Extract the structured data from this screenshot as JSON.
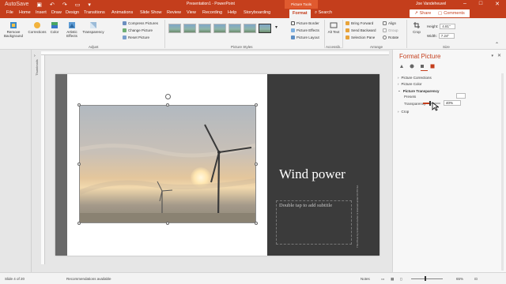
{
  "titlebar": {
    "autosave": "AutoSave",
    "document_title": "Presentation1 - PowerPoint",
    "context_tab": "Picture Tools",
    "user": "Joe Vandeheuvel"
  },
  "tabs": [
    "File",
    "Home",
    "Insert",
    "Draw",
    "Design",
    "Transitions",
    "Animations",
    "Slide Show",
    "Review",
    "View",
    "Recording",
    "Help",
    "Storyboarding",
    "Format"
  ],
  "active_tab": "Format",
  "search_label": "Search",
  "share_label": "Share",
  "comments_label": "Comments",
  "ribbon": {
    "remove_background": "Remove Background",
    "corrections": "Corrections",
    "color": "Color",
    "artistic_effects": "Artistic Effects",
    "transparency": "Transparency",
    "compress_pictures": "Compress Pictures",
    "change_picture": "Change Picture",
    "reset_picture": "Reset Picture",
    "group_adjust": "Adjust",
    "group_picture_styles": "Picture Styles",
    "picture_border": "Picture Border",
    "picture_effects": "Picture Effects",
    "picture_layout": "Picture Layout",
    "group_accessibility": "Accessib...",
    "alt_text": "Alt Text",
    "bring_forward": "Bring Forward",
    "send_backward": "Send Backward",
    "selection_pane": "Selection Pane",
    "align": "Align",
    "group": "Group",
    "rotate": "Rotate",
    "group_arrange": "Arrange",
    "crop": "Crop",
    "height_label": "Height:",
    "height_value": "4.81\"",
    "width_label": "Width:",
    "width_value": "7.24\"",
    "group_size": "Size"
  },
  "thumbnails_label": "Thumbnails",
  "slide": {
    "title": "Wind power",
    "subtitle_placeholder": "Double tap to add subtitle",
    "credit": "This Photo by Unknown Author is licensed under CC BY-SA"
  },
  "format_pane": {
    "title": "Format Picture",
    "sections": [
      "Picture Corrections",
      "Picture Color",
      "Picture Transparency",
      "Crop"
    ],
    "expanded_section": "Picture Transparency",
    "presets_label": "Presets",
    "transparency_label": "Transparency",
    "transparency_value": "40%",
    "transparency_fraction": 0.4
  },
  "status": {
    "slide_info": "Slide 4 of 20",
    "recommendations": "Recommendations available",
    "notes": "Notes",
    "zoom": "65%"
  },
  "colors": {
    "accent": "#c43e1c",
    "slide_dark_panel": "#3b3b3b"
  }
}
